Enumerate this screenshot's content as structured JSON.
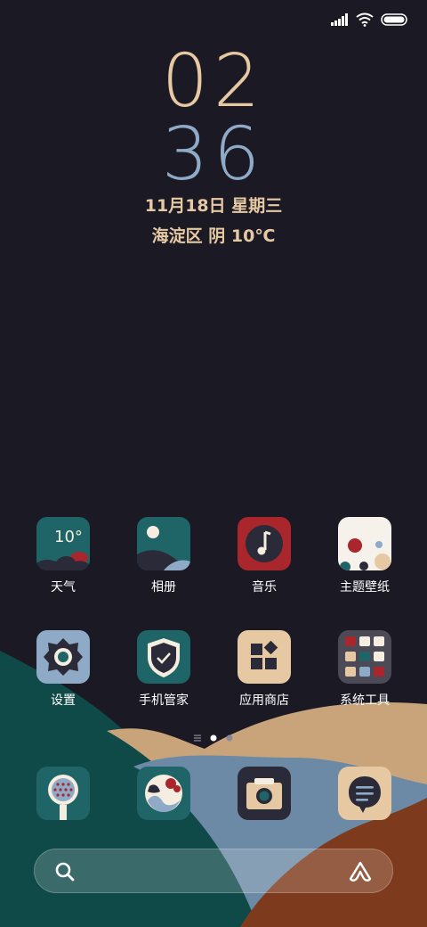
{
  "status_bar": {
    "icons": [
      "signal-icon",
      "wifi-icon",
      "battery-icon"
    ]
  },
  "clock": {
    "hour": "02",
    "minute": "36",
    "date": "11月18日 星期三",
    "weather": "海淀区 阴 10℃"
  },
  "apps_row1": [
    {
      "label": "天气",
      "icon": "weather-icon",
      "temp": "10°"
    },
    {
      "label": "相册",
      "icon": "gallery-icon"
    },
    {
      "label": "音乐",
      "icon": "music-icon"
    },
    {
      "label": "主题壁纸",
      "icon": "themes-icon"
    }
  ],
  "apps_row2": [
    {
      "label": "设置",
      "icon": "settings-icon"
    },
    {
      "label": "手机管家",
      "icon": "security-icon"
    },
    {
      "label": "应用商店",
      "icon": "app-store-icon"
    },
    {
      "label": "系统工具",
      "icon": "tools-folder-icon"
    }
  ],
  "dock": [
    {
      "icon": "phone-icon"
    },
    {
      "icon": "browser-icon"
    },
    {
      "icon": "camera-icon"
    },
    {
      "icon": "messages-icon"
    }
  ],
  "page_indicator": {
    "pages": 3,
    "current": 2
  },
  "search": {
    "placeholder": ""
  },
  "colors": {
    "background": "#1b1a24",
    "accent_beige": "#e6c9a3",
    "accent_blue": "#8eaac6",
    "teal": "#1f6466",
    "red": "#a8262c"
  }
}
